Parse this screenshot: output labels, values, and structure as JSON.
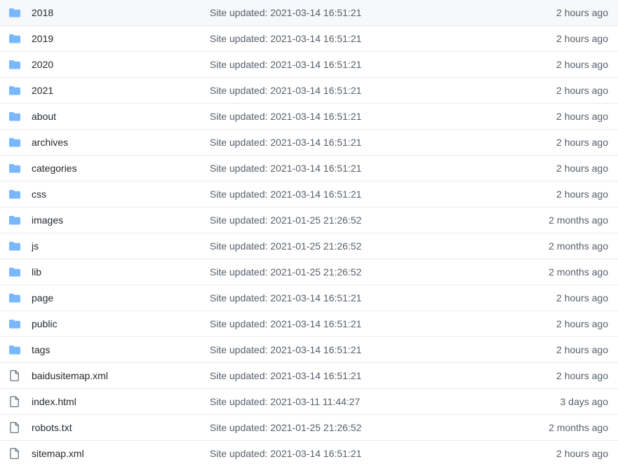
{
  "colors": {
    "folder": "#79b8ff",
    "file": "#6a737d",
    "text": "#24292e",
    "muted": "#586069",
    "border": "#eaecef"
  },
  "rows": [
    {
      "type": "folder",
      "icon": "folder-icon",
      "name": "2018",
      "message": "Site updated: 2021-03-14 16:51:21",
      "age": "2 hours ago"
    },
    {
      "type": "folder",
      "icon": "folder-icon",
      "name": "2019",
      "message": "Site updated: 2021-03-14 16:51:21",
      "age": "2 hours ago"
    },
    {
      "type": "folder",
      "icon": "folder-icon",
      "name": "2020",
      "message": "Site updated: 2021-03-14 16:51:21",
      "age": "2 hours ago"
    },
    {
      "type": "folder",
      "icon": "folder-icon",
      "name": "2021",
      "message": "Site updated: 2021-03-14 16:51:21",
      "age": "2 hours ago"
    },
    {
      "type": "folder",
      "icon": "folder-icon",
      "name": "about",
      "message": "Site updated: 2021-03-14 16:51:21",
      "age": "2 hours ago"
    },
    {
      "type": "folder",
      "icon": "folder-icon",
      "name": "archives",
      "message": "Site updated: 2021-03-14 16:51:21",
      "age": "2 hours ago"
    },
    {
      "type": "folder",
      "icon": "folder-icon",
      "name": "categories",
      "message": "Site updated: 2021-03-14 16:51:21",
      "age": "2 hours ago"
    },
    {
      "type": "folder",
      "icon": "folder-icon",
      "name": "css",
      "message": "Site updated: 2021-03-14 16:51:21",
      "age": "2 hours ago"
    },
    {
      "type": "folder",
      "icon": "folder-icon",
      "name": "images",
      "message": "Site updated: 2021-01-25 21:26:52",
      "age": "2 months ago"
    },
    {
      "type": "folder",
      "icon": "folder-icon",
      "name": "js",
      "message": "Site updated: 2021-01-25 21:26:52",
      "age": "2 months ago"
    },
    {
      "type": "folder",
      "icon": "folder-icon",
      "name": "lib",
      "message": "Site updated: 2021-01-25 21:26:52",
      "age": "2 months ago"
    },
    {
      "type": "folder",
      "icon": "folder-icon",
      "name": "page",
      "message": "Site updated: 2021-03-14 16:51:21",
      "age": "2 hours ago"
    },
    {
      "type": "folder",
      "icon": "folder-icon",
      "name": "public",
      "message": "Site updated: 2021-03-14 16:51:21",
      "age": "2 hours ago"
    },
    {
      "type": "folder",
      "icon": "folder-icon",
      "name": "tags",
      "message": "Site updated: 2021-03-14 16:51:21",
      "age": "2 hours ago"
    },
    {
      "type": "file",
      "icon": "file-icon",
      "name": "baidusitemap.xml",
      "message": "Site updated: 2021-03-14 16:51:21",
      "age": "2 hours ago"
    },
    {
      "type": "file",
      "icon": "file-icon",
      "name": "index.html",
      "message": "Site updated: 2021-03-11 11:44:27",
      "age": "3 days ago"
    },
    {
      "type": "file",
      "icon": "file-icon",
      "name": "robots.txt",
      "message": "Site updated: 2021-01-25 21:26:52",
      "age": "2 months ago"
    },
    {
      "type": "file",
      "icon": "file-icon",
      "name": "sitemap.xml",
      "message": "Site updated: 2021-03-14 16:51:21",
      "age": "2 hours ago"
    }
  ]
}
